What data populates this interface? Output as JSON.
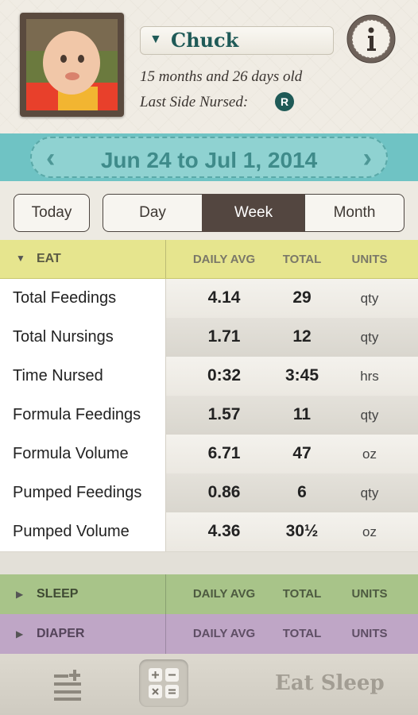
{
  "header": {
    "child_name": "Chuck",
    "age": "15 months and 26 days old",
    "last_side_label": "Last Side Nursed:",
    "last_side_value": "R"
  },
  "date_range": "Jun 24 to Jul 1, 2014",
  "range_buttons": {
    "today": "Today",
    "day": "Day",
    "week": "Week",
    "month": "Month",
    "selected": "Week"
  },
  "columns": {
    "daily_avg": "DAILY AVG",
    "total": "TOTAL",
    "units": "UNITS"
  },
  "sections": {
    "eat": "EAT",
    "sleep": "SLEEP",
    "diaper": "DIAPER"
  },
  "eat_rows": [
    {
      "label": "Total Feedings",
      "avg": "4.14",
      "total": "29",
      "unit": "qty"
    },
    {
      "label": "Total Nursings",
      "avg": "1.71",
      "total": "12",
      "unit": "qty"
    },
    {
      "label": "Time Nursed",
      "avg": "0:32",
      "total": "3:45",
      "unit": "hrs"
    },
    {
      "label": "Formula Feedings",
      "avg": "1.57",
      "total": "11",
      "unit": "qty"
    },
    {
      "label": "Formula Volume",
      "avg": "6.71",
      "total": "47",
      "unit": "oz"
    },
    {
      "label": "Pumped Feedings",
      "avg": "0.86",
      "total": "6",
      "unit": "qty"
    },
    {
      "label": "Pumped Volume",
      "avg": "4.36",
      "total": "30½",
      "unit": "oz"
    }
  ],
  "tabbar": {
    "brand": "Eat Sleep"
  },
  "colors": {
    "teal": "#1f5a57",
    "date_bar": "#6fc3c4",
    "eat": "#e6e58e",
    "sleep": "#a8c489",
    "diaper": "#bfa6c6",
    "selected_segment": "#534640"
  }
}
